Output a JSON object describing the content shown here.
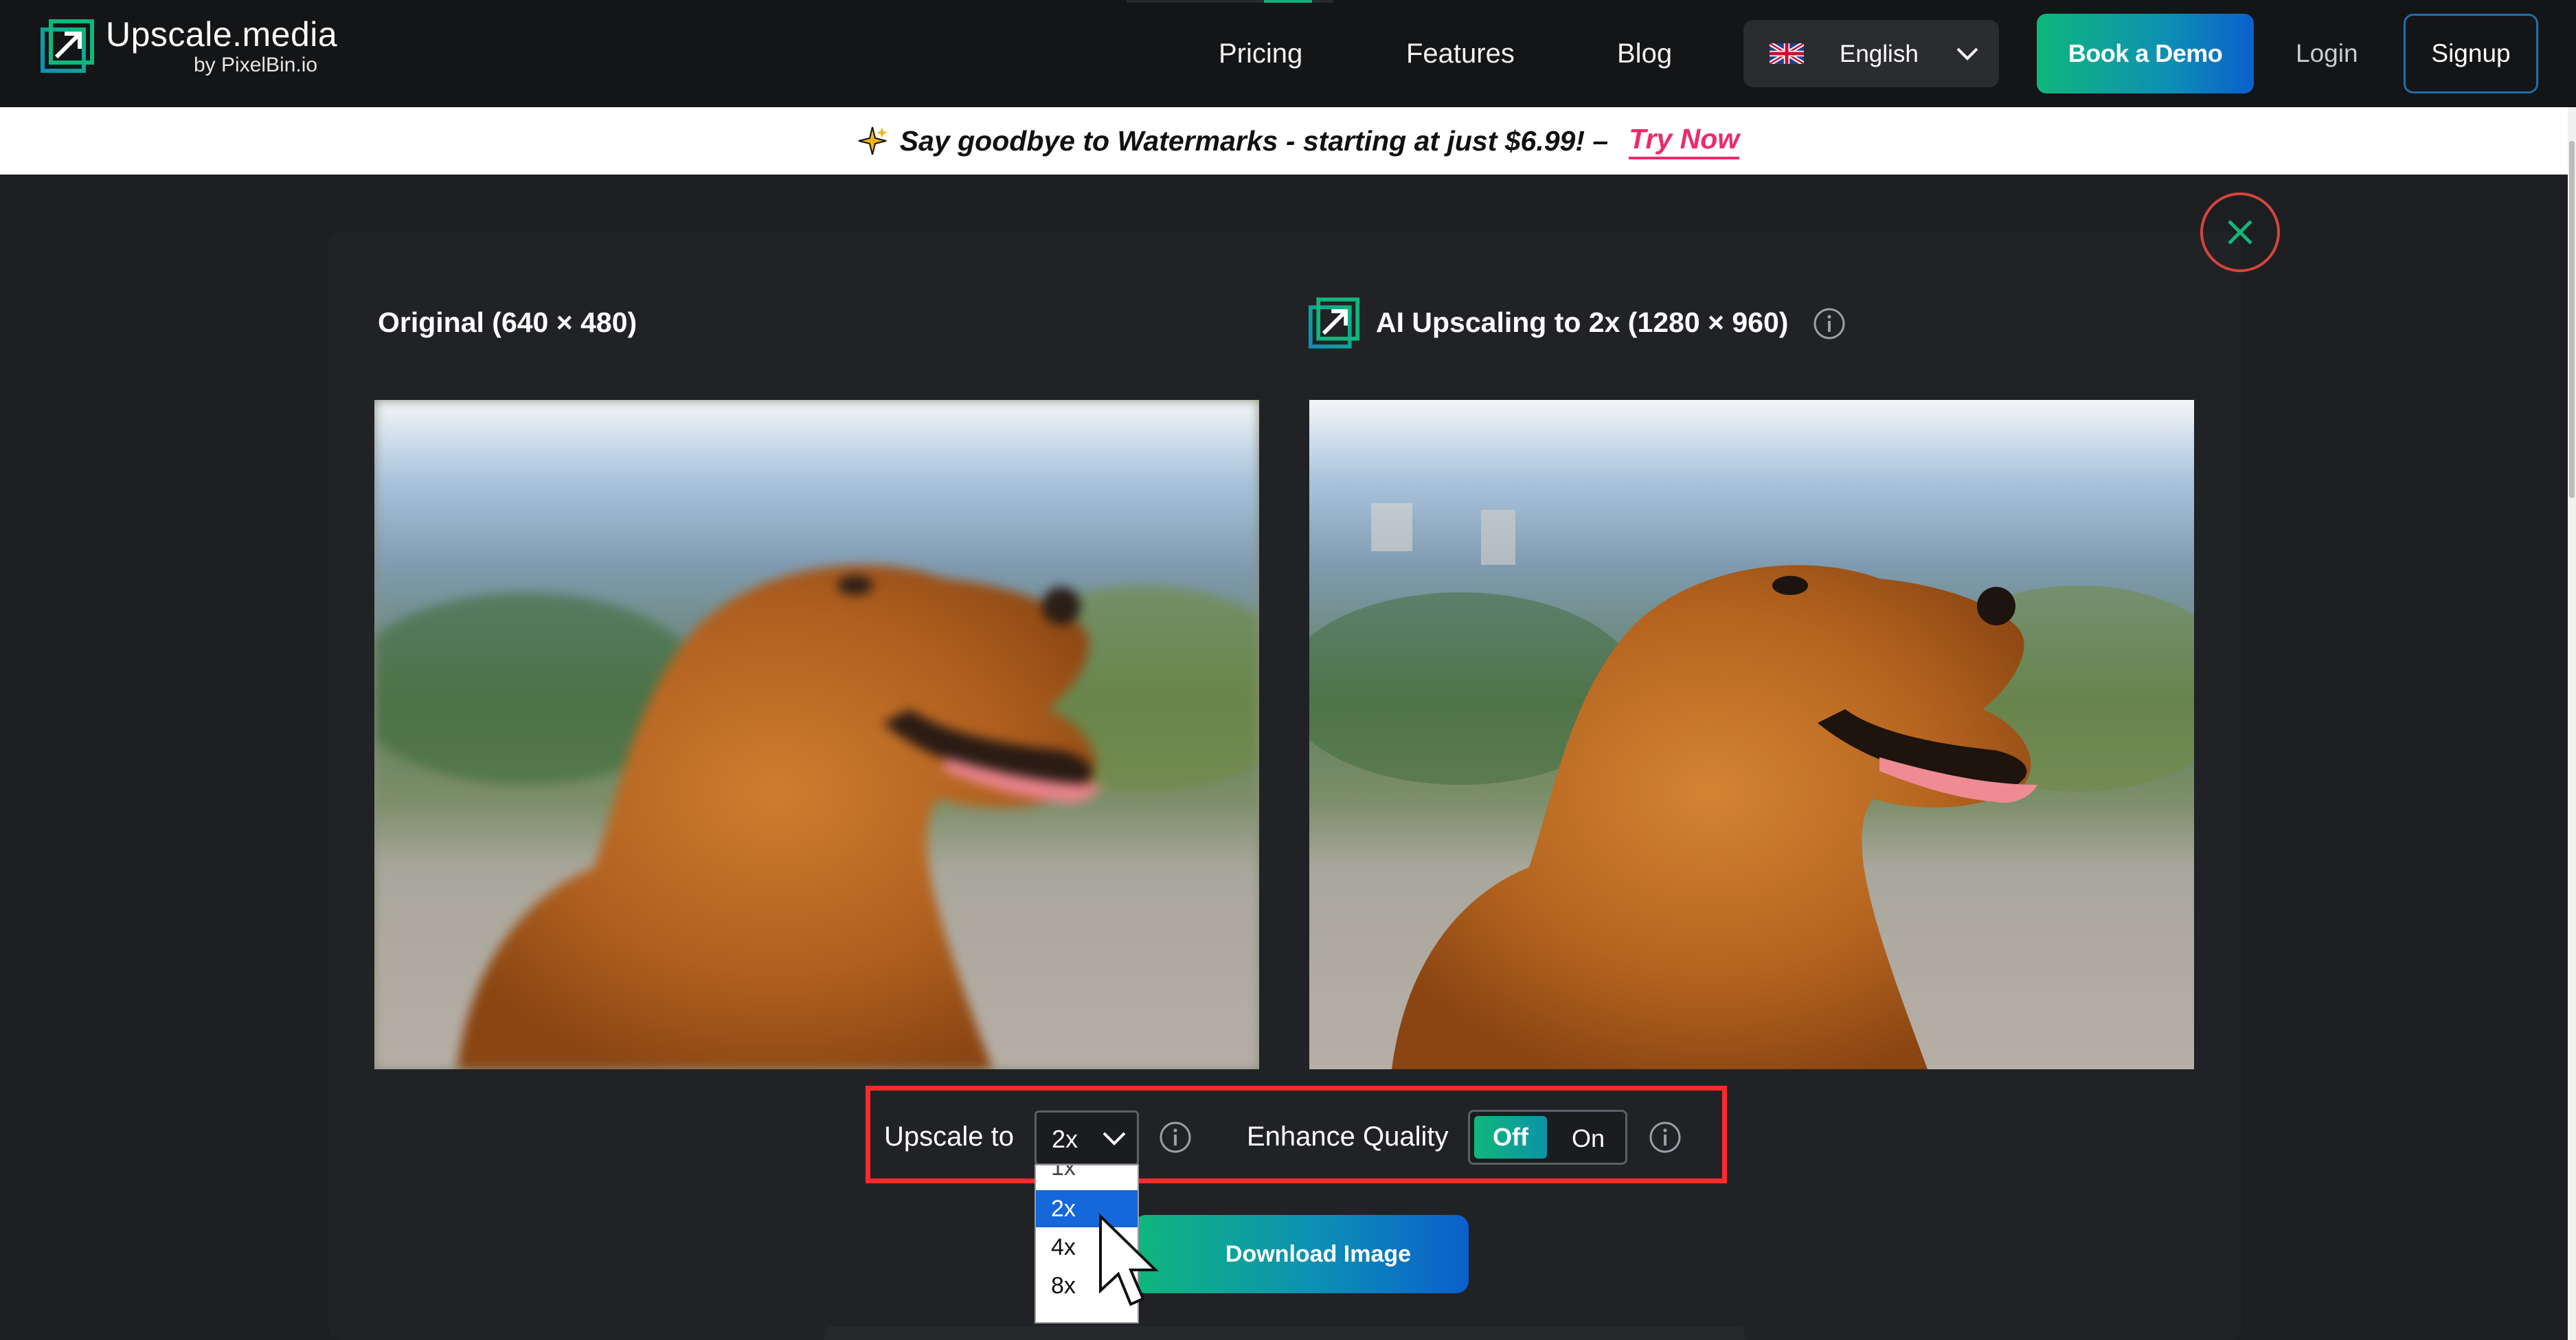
{
  "brand": {
    "title": "Upscale.media",
    "subtitle": "by PixelBin.io",
    "accent": "#0fb77b"
  },
  "nav": {
    "pricing": "Pricing",
    "features": "Features",
    "blog": "Blog"
  },
  "language": {
    "selected": "English",
    "flag_icon": "uk-flag-icon"
  },
  "header_buttons": {
    "demo": "Book a Demo",
    "login": "Login",
    "signup": "Signup"
  },
  "banner": {
    "text": "Say goodbye to Watermarks - starting at just $6.99! –",
    "link": "Try Now",
    "link_color": "#ec2b6a"
  },
  "panel": {
    "original_label": "Original (640 × 480)",
    "ai_label": "AI Upscaling to 2x (1280 × 960)"
  },
  "controls": {
    "upscale_label": "Upscale to",
    "upscale_value": "2x",
    "options": [
      "1x",
      "2x",
      "4x",
      "8x"
    ],
    "enhance_label": "Enhance Quality",
    "toggle_off": "Off",
    "toggle_on": "On"
  },
  "download_label": "Download Image",
  "highlight_color": "#ff2b2b"
}
